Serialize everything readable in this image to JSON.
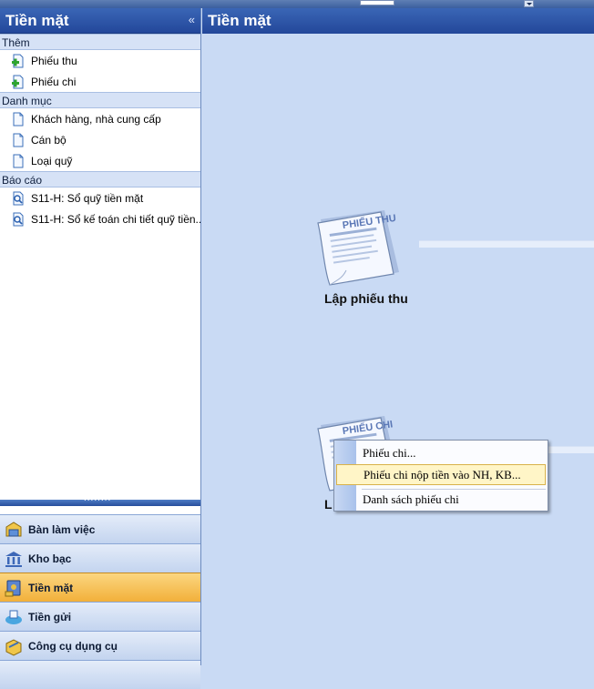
{
  "left_panel": {
    "title": "Tiền mặt",
    "collapse_glyph": "«",
    "sections": [
      {
        "label": "Thêm",
        "items": [
          {
            "label": "Phiếu thu",
            "icon": "add-document-icon"
          },
          {
            "label": "Phiếu chi",
            "icon": "add-document-icon"
          }
        ]
      },
      {
        "label": "Danh mục",
        "items": [
          {
            "label": "Khách hàng, nhà cung cấp",
            "icon": "document-icon"
          },
          {
            "label": "Cán bộ",
            "icon": "document-icon"
          },
          {
            "label": "Loại quỹ",
            "icon": "document-icon"
          }
        ]
      },
      {
        "label": "Báo cáo",
        "items": [
          {
            "label": "S11-H: Sổ quỹ tiền mặt",
            "icon": "report-icon"
          },
          {
            "label": "S11-H: Sổ kế toán chi tiết quỹ tiền...",
            "icon": "report-icon"
          }
        ]
      }
    ]
  },
  "nav": [
    {
      "label": "Bàn làm việc",
      "icon": "desk-icon",
      "active": false
    },
    {
      "label": "Kho bạc",
      "icon": "bank-icon",
      "active": false
    },
    {
      "label": "Tiền mặt",
      "icon": "cash-safe-icon",
      "active": true
    },
    {
      "label": "Tiền gửi",
      "icon": "deposit-icon",
      "active": false
    },
    {
      "label": "Công cụ dụng cụ",
      "icon": "tools-icon",
      "active": false
    }
  ],
  "main": {
    "title": "Tiền mặt",
    "receipt": {
      "doc_text": "PHIẾU THU",
      "label": "Lập phiếu thu"
    },
    "payment": {
      "doc_text": "PHIẾU CHI",
      "label": "Lập phiếu chi",
      "visible_label": "L"
    }
  },
  "context_menu": {
    "items": [
      {
        "label": "Phiếu chi...",
        "highlighted": false
      },
      {
        "label": "Phiếu chi nộp tiền vào NH, KB...",
        "highlighted": true
      },
      {
        "label": "Danh sách phiếu chi",
        "highlighted": false
      }
    ]
  },
  "colors": {
    "header_blue": "#23479a",
    "workspace": "#c9daf4",
    "active_nav": "#f2b03a",
    "menu_highlight": "#fff5c7"
  }
}
